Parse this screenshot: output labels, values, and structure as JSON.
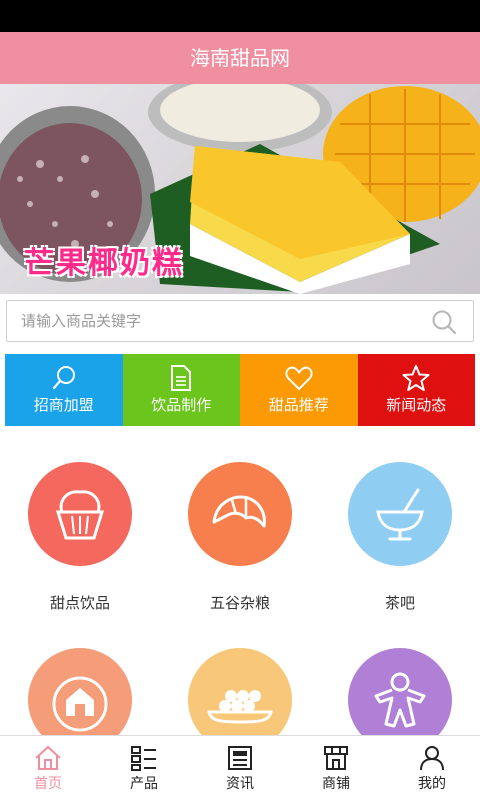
{
  "app": {
    "title": "海南甜品网"
  },
  "banner": {
    "caption": "芒果椰奶糕",
    "slide_count": 5,
    "active_slide": 5
  },
  "search": {
    "placeholder": "请输入商品关键字"
  },
  "quick_links": [
    {
      "label": "招商加盟",
      "icon": "search-icon",
      "color": "#1aa3e8"
    },
    {
      "label": "饮品制作",
      "icon": "document-icon",
      "color": "#6cc51c"
    },
    {
      "label": "甜品推荐",
      "icon": "heart-icon",
      "color": "#fb9a04"
    },
    {
      "label": "新闻动态",
      "icon": "star-icon",
      "color": "#de1010"
    }
  ],
  "categories": [
    {
      "label": "甜点饮品",
      "icon": "cupcake-icon",
      "color": "#f4685e"
    },
    {
      "label": "五谷杂粮",
      "icon": "croissant-icon",
      "color": "#f77f4d"
    },
    {
      "label": "茶吧",
      "icon": "drink-bowl-icon",
      "color": "#8fcdf3"
    },
    {
      "label": "",
      "icon": "house-icon",
      "color": "#f59c79"
    },
    {
      "label": "",
      "icon": "dumpling-plate-icon",
      "color": "#f8c77a"
    },
    {
      "label": "",
      "icon": "gingerbread-icon",
      "color": "#b07fd6"
    }
  ],
  "tabbar": [
    {
      "label": "首页",
      "icon": "home-icon",
      "active": true
    },
    {
      "label": "产品",
      "icon": "grid-list-icon",
      "active": false
    },
    {
      "label": "资讯",
      "icon": "news-icon",
      "active": false
    },
    {
      "label": "商铺",
      "icon": "shop-icon",
      "active": false
    },
    {
      "label": "我的",
      "icon": "user-icon",
      "active": false
    }
  ],
  "colors": {
    "header": "#f08fa0",
    "active_tab": "#f08fa0",
    "active_dot": "#e0001a"
  }
}
